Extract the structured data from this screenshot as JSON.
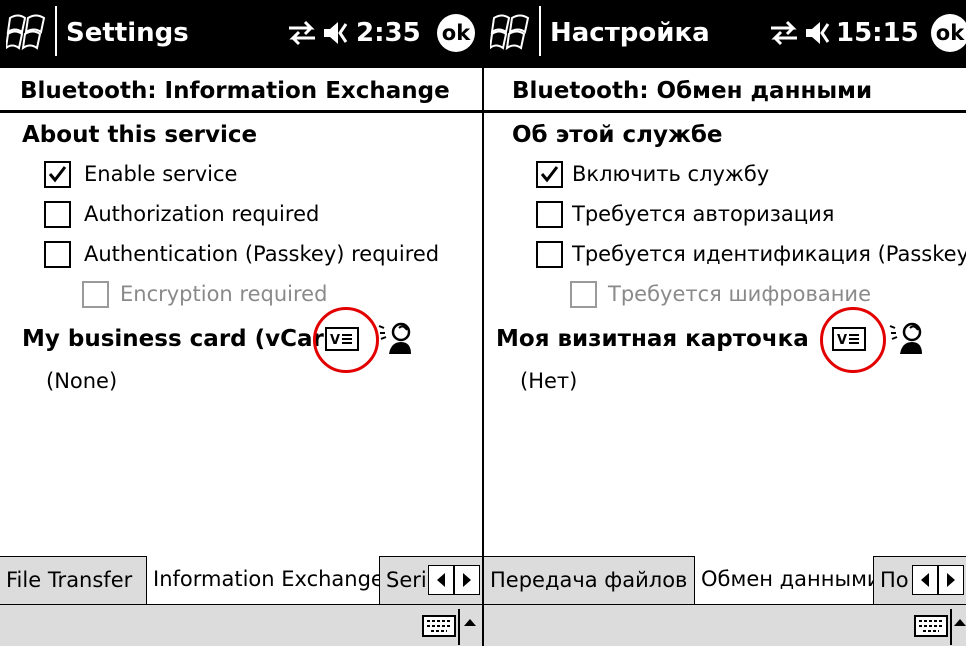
{
  "left": {
    "title": "Settings",
    "time": "2:35",
    "ok": "ok",
    "subtitle": "Bluetooth: Information Exchange",
    "section": "About this service",
    "options": [
      {
        "label": "Enable service",
        "checked": true,
        "enabled": true
      },
      {
        "label": "Authorization required",
        "checked": false,
        "enabled": true
      },
      {
        "label": "Authentication (Passkey) required",
        "checked": false,
        "enabled": true
      },
      {
        "label": "Encryption required",
        "checked": false,
        "enabled": false
      }
    ],
    "vcard_label": "My business card (vCard)",
    "vcard_value": "(None)",
    "tabs": [
      "File Transfer",
      "Information Exchange",
      "Seri"
    ]
  },
  "right": {
    "title": "Настройка",
    "time": "15:15",
    "ok": "ok",
    "subtitle": "Bluetooth: Обмен данными",
    "section": "Об этой службе",
    "options": [
      {
        "label": "Включить службу",
        "checked": true,
        "enabled": true
      },
      {
        "label": "Требуется авторизация",
        "checked": false,
        "enabled": true
      },
      {
        "label": "Требуется идентификация (Passkey)",
        "checked": false,
        "enabled": true
      },
      {
        "label": "Требуется шифрование",
        "checked": false,
        "enabled": false
      }
    ],
    "vcard_label": "Моя визитная карточка",
    "vcard_value": "(Нет)",
    "tabs": [
      "Передача файлов",
      "Обмен данными",
      "По"
    ]
  },
  "icons": {
    "start": "windows-start-icon",
    "connectivity": "connectivity-icon",
    "volume": "speaker-icon",
    "vcard": "vcard-icon",
    "contacts": "contact-person-icon",
    "keyboard": "keyboard-icon",
    "scroll_left": "triangle-left-icon",
    "scroll_right": "triangle-right-icon",
    "sip": "up-arrow-icon"
  },
  "colors": {
    "highlight_circle": "#e30000",
    "titlebar": "#000000",
    "bars": "#dcdcdc"
  }
}
